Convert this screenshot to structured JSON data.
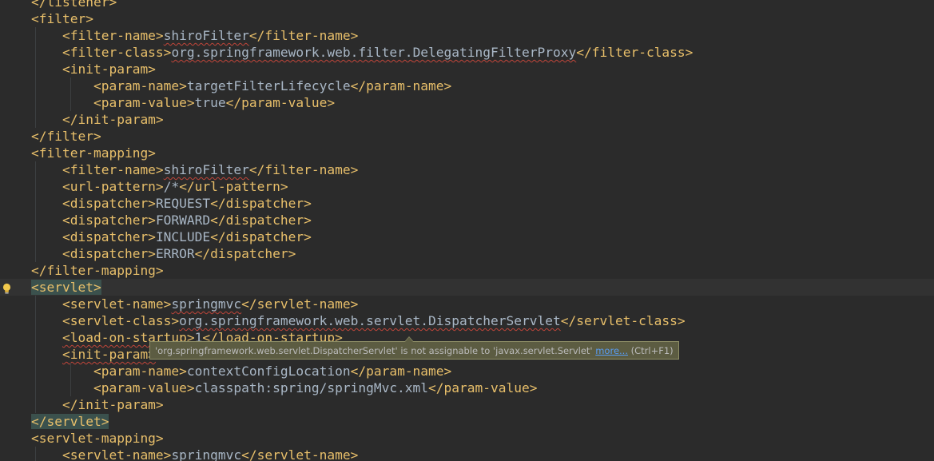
{
  "editor": {
    "lines": [
      [
        {
          "t": "</listener>",
          "c": "tag"
        }
      ],
      [
        {
          "t": "<filter>",
          "c": "tag"
        }
      ],
      [
        {
          "t": "    "
        },
        {
          "t": "<filter-name>",
          "c": "tag"
        },
        {
          "t": "shiroFilter",
          "c": "typo"
        },
        {
          "t": "</filter-name>",
          "c": "tag"
        }
      ],
      [
        {
          "t": "    "
        },
        {
          "t": "<filter-class>",
          "c": "tag"
        },
        {
          "t": "org.springframework.web.filter.",
          "c": "typo"
        },
        {
          "t": "DelegatingFilterProxy",
          "c": "typo"
        },
        {
          "t": "</filter-class>",
          "c": "tag"
        }
      ],
      [
        {
          "t": "    "
        },
        {
          "t": "<init-param>",
          "c": "tag"
        }
      ],
      [
        {
          "t": "        "
        },
        {
          "t": "<param-name>",
          "c": "tag"
        },
        {
          "t": "targetFilterLifecycle",
          "c": "txt"
        },
        {
          "t": "</param-name>",
          "c": "tag"
        }
      ],
      [
        {
          "t": "        "
        },
        {
          "t": "<param-value>",
          "c": "tag"
        },
        {
          "t": "true",
          "c": "txt"
        },
        {
          "t": "</param-value>",
          "c": "tag"
        }
      ],
      [
        {
          "t": "    "
        },
        {
          "t": "</init-param>",
          "c": "tag"
        }
      ],
      [
        {
          "t": "</filter>",
          "c": "tag"
        }
      ],
      [
        {
          "t": "<filter-mapping>",
          "c": "tag"
        }
      ],
      [
        {
          "t": "    "
        },
        {
          "t": "<filter-name>",
          "c": "tag"
        },
        {
          "t": "shiroFilter",
          "c": "typo"
        },
        {
          "t": "</filter-name>",
          "c": "tag"
        }
      ],
      [
        {
          "t": "    "
        },
        {
          "t": "<url-pattern>",
          "c": "tag"
        },
        {
          "t": "/*",
          "c": "txt"
        },
        {
          "t": "</url-pattern>",
          "c": "tag"
        }
      ],
      [
        {
          "t": "    "
        },
        {
          "t": "<dispatcher>",
          "c": "tag"
        },
        {
          "t": "REQUEST",
          "c": "txt"
        },
        {
          "t": "</dispatcher>",
          "c": "tag"
        }
      ],
      [
        {
          "t": "    "
        },
        {
          "t": "<dispatcher>",
          "c": "tag"
        },
        {
          "t": "FORWARD",
          "c": "txt"
        },
        {
          "t": "</dispatcher>",
          "c": "tag"
        }
      ],
      [
        {
          "t": "    "
        },
        {
          "t": "<dispatcher>",
          "c": "tag"
        },
        {
          "t": "INCLUDE",
          "c": "txt"
        },
        {
          "t": "</dispatcher>",
          "c": "tag"
        }
      ],
      [
        {
          "t": "    "
        },
        {
          "t": "<dispatcher>",
          "c": "tag"
        },
        {
          "t": "ERROR",
          "c": "txt"
        },
        {
          "t": "</dispatcher>",
          "c": "tag"
        }
      ],
      [
        {
          "t": "</filter-mapping>",
          "c": "tag"
        }
      ],
      [
        {
          "t": "<servlet>",
          "c": "tag match"
        }
      ],
      [
        {
          "t": "    "
        },
        {
          "t": "<servlet-name>",
          "c": "tag"
        },
        {
          "t": "springmvc",
          "c": "typo"
        },
        {
          "t": "</servlet-name>",
          "c": "tag"
        }
      ],
      [
        {
          "t": "    "
        },
        {
          "t": "<servlet-class>",
          "c": "tag"
        },
        {
          "t": "org.springframework.web.servlet.DispatcherServlet",
          "c": "typo"
        },
        {
          "t": "</servlet-class>",
          "c": "tag"
        }
      ],
      [
        {
          "t": "    "
        },
        {
          "t": "<load-on-startup>",
          "c": "tag typo"
        },
        {
          "t": "1",
          "c": "txt"
        },
        {
          "t": "</load-on-startup>",
          "c": "tag"
        }
      ],
      [
        {
          "t": "    "
        },
        {
          "t": "<init-param>",
          "c": "tag typo"
        }
      ],
      [
        {
          "t": "        "
        },
        {
          "t": "<param-name>",
          "c": "tag"
        },
        {
          "t": "contextConfigLocation",
          "c": "txt"
        },
        {
          "t": "</param-name>",
          "c": "tag"
        }
      ],
      [
        {
          "t": "        "
        },
        {
          "t": "<param-value>",
          "c": "tag"
        },
        {
          "t": "classpath:spring/springMvc.xml",
          "c": "txt"
        },
        {
          "t": "</param-value>",
          "c": "tag"
        }
      ],
      [
        {
          "t": "    "
        },
        {
          "t": "</init-param>",
          "c": "tag"
        }
      ],
      [
        {
          "t": "</servlet>",
          "c": "tag match"
        }
      ],
      [
        {
          "t": "<servlet-mapping>",
          "c": "tag"
        }
      ],
      [
        {
          "t": "    "
        },
        {
          "t": "<servlet-name>",
          "c": "tag"
        },
        {
          "t": "springmvc",
          "c": "typo"
        },
        {
          "t": "</servlet-name>",
          "c": "tag"
        }
      ]
    ]
  },
  "tooltip": {
    "message": "'org.springframework.web.servlet.DispatcherServlet' is not assignable to 'javax.servlet.Servlet' ",
    "more_link": "more...",
    "shortcut": " (Ctrl+F1)"
  },
  "icons": {
    "intention": "lightbulb-icon"
  },
  "colors": {
    "background": "#2b2b2b",
    "tag": "#e8bf6a",
    "text": "#a9b7c6",
    "error_underline": "#c0453a",
    "tag_match_highlight": "#3b514d",
    "tooltip_background": "#5c5c42",
    "link": "#589df6"
  }
}
